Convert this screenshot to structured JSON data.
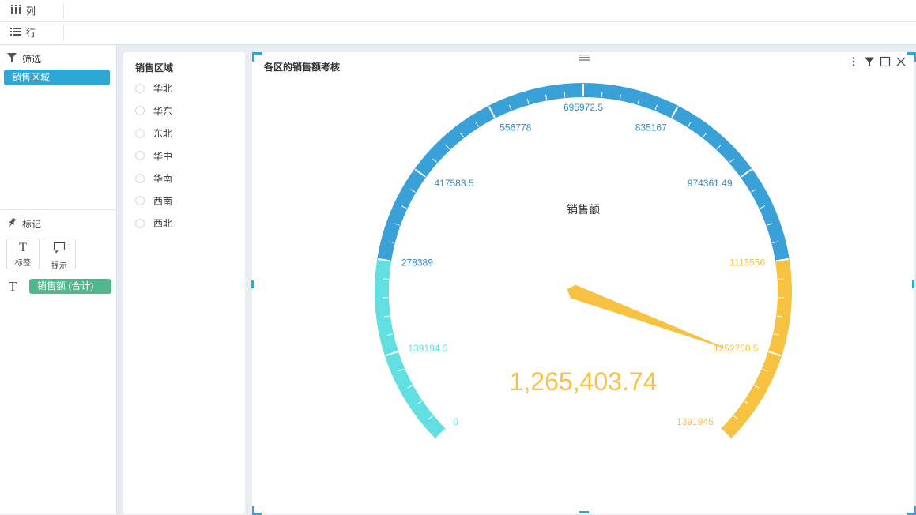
{
  "shelves": {
    "columns_label": "列",
    "rows_label": "行"
  },
  "left_panel": {
    "filter_title": "筛选",
    "filter_pill": "销售区域",
    "marks_title": "标记",
    "mark_buttons": [
      {
        "glyph": "T",
        "label": "标签",
        "icon": "text-label-icon"
      },
      {
        "glyph": "",
        "label": "提示",
        "icon": "tooltip-icon"
      }
    ],
    "measure_pill": "销售额 (合计)"
  },
  "filter_panel": {
    "title": "销售区域",
    "options": [
      "华北",
      "华东",
      "东北",
      "华中",
      "华南",
      "西南",
      "西北"
    ]
  },
  "chart_panel": {
    "title": "各区的销售额考核",
    "icons": [
      "more-vertical-icon",
      "filter-icon",
      "maximize-icon",
      "close-icon"
    ]
  },
  "chart_data": {
    "type": "gauge",
    "title": "销售额",
    "value": 1265403.74,
    "value_label": "1,265,403.74",
    "min": 0,
    "max": 1391945,
    "tick_labels": [
      {
        "value": 0,
        "label": "0"
      },
      {
        "value": 139194.5,
        "label": "139194.5"
      },
      {
        "value": 278389,
        "label": "278389"
      },
      {
        "value": 417583.5,
        "label": "417583.5"
      },
      {
        "value": 556778,
        "label": "556778"
      },
      {
        "value": 695972.5,
        "label": "695972.5"
      },
      {
        "value": 835167,
        "label": "835167"
      },
      {
        "value": 974361.49,
        "label": "974361.49"
      },
      {
        "value": 1113556,
        "label": "1113556"
      },
      {
        "value": 1252750.5,
        "label": "1252750.5"
      },
      {
        "value": 1391945,
        "label": "1391945"
      }
    ],
    "bands": [
      {
        "from": 0,
        "to": 278389,
        "color": "#62dfe1"
      },
      {
        "from": 278389,
        "to": 1113556,
        "color": "#3aa0d8"
      },
      {
        "from": 1113556,
        "to": 1391945,
        "color": "#f7c142"
      }
    ],
    "pointer_color": "#f7c142",
    "value_color": "#f7c142"
  }
}
